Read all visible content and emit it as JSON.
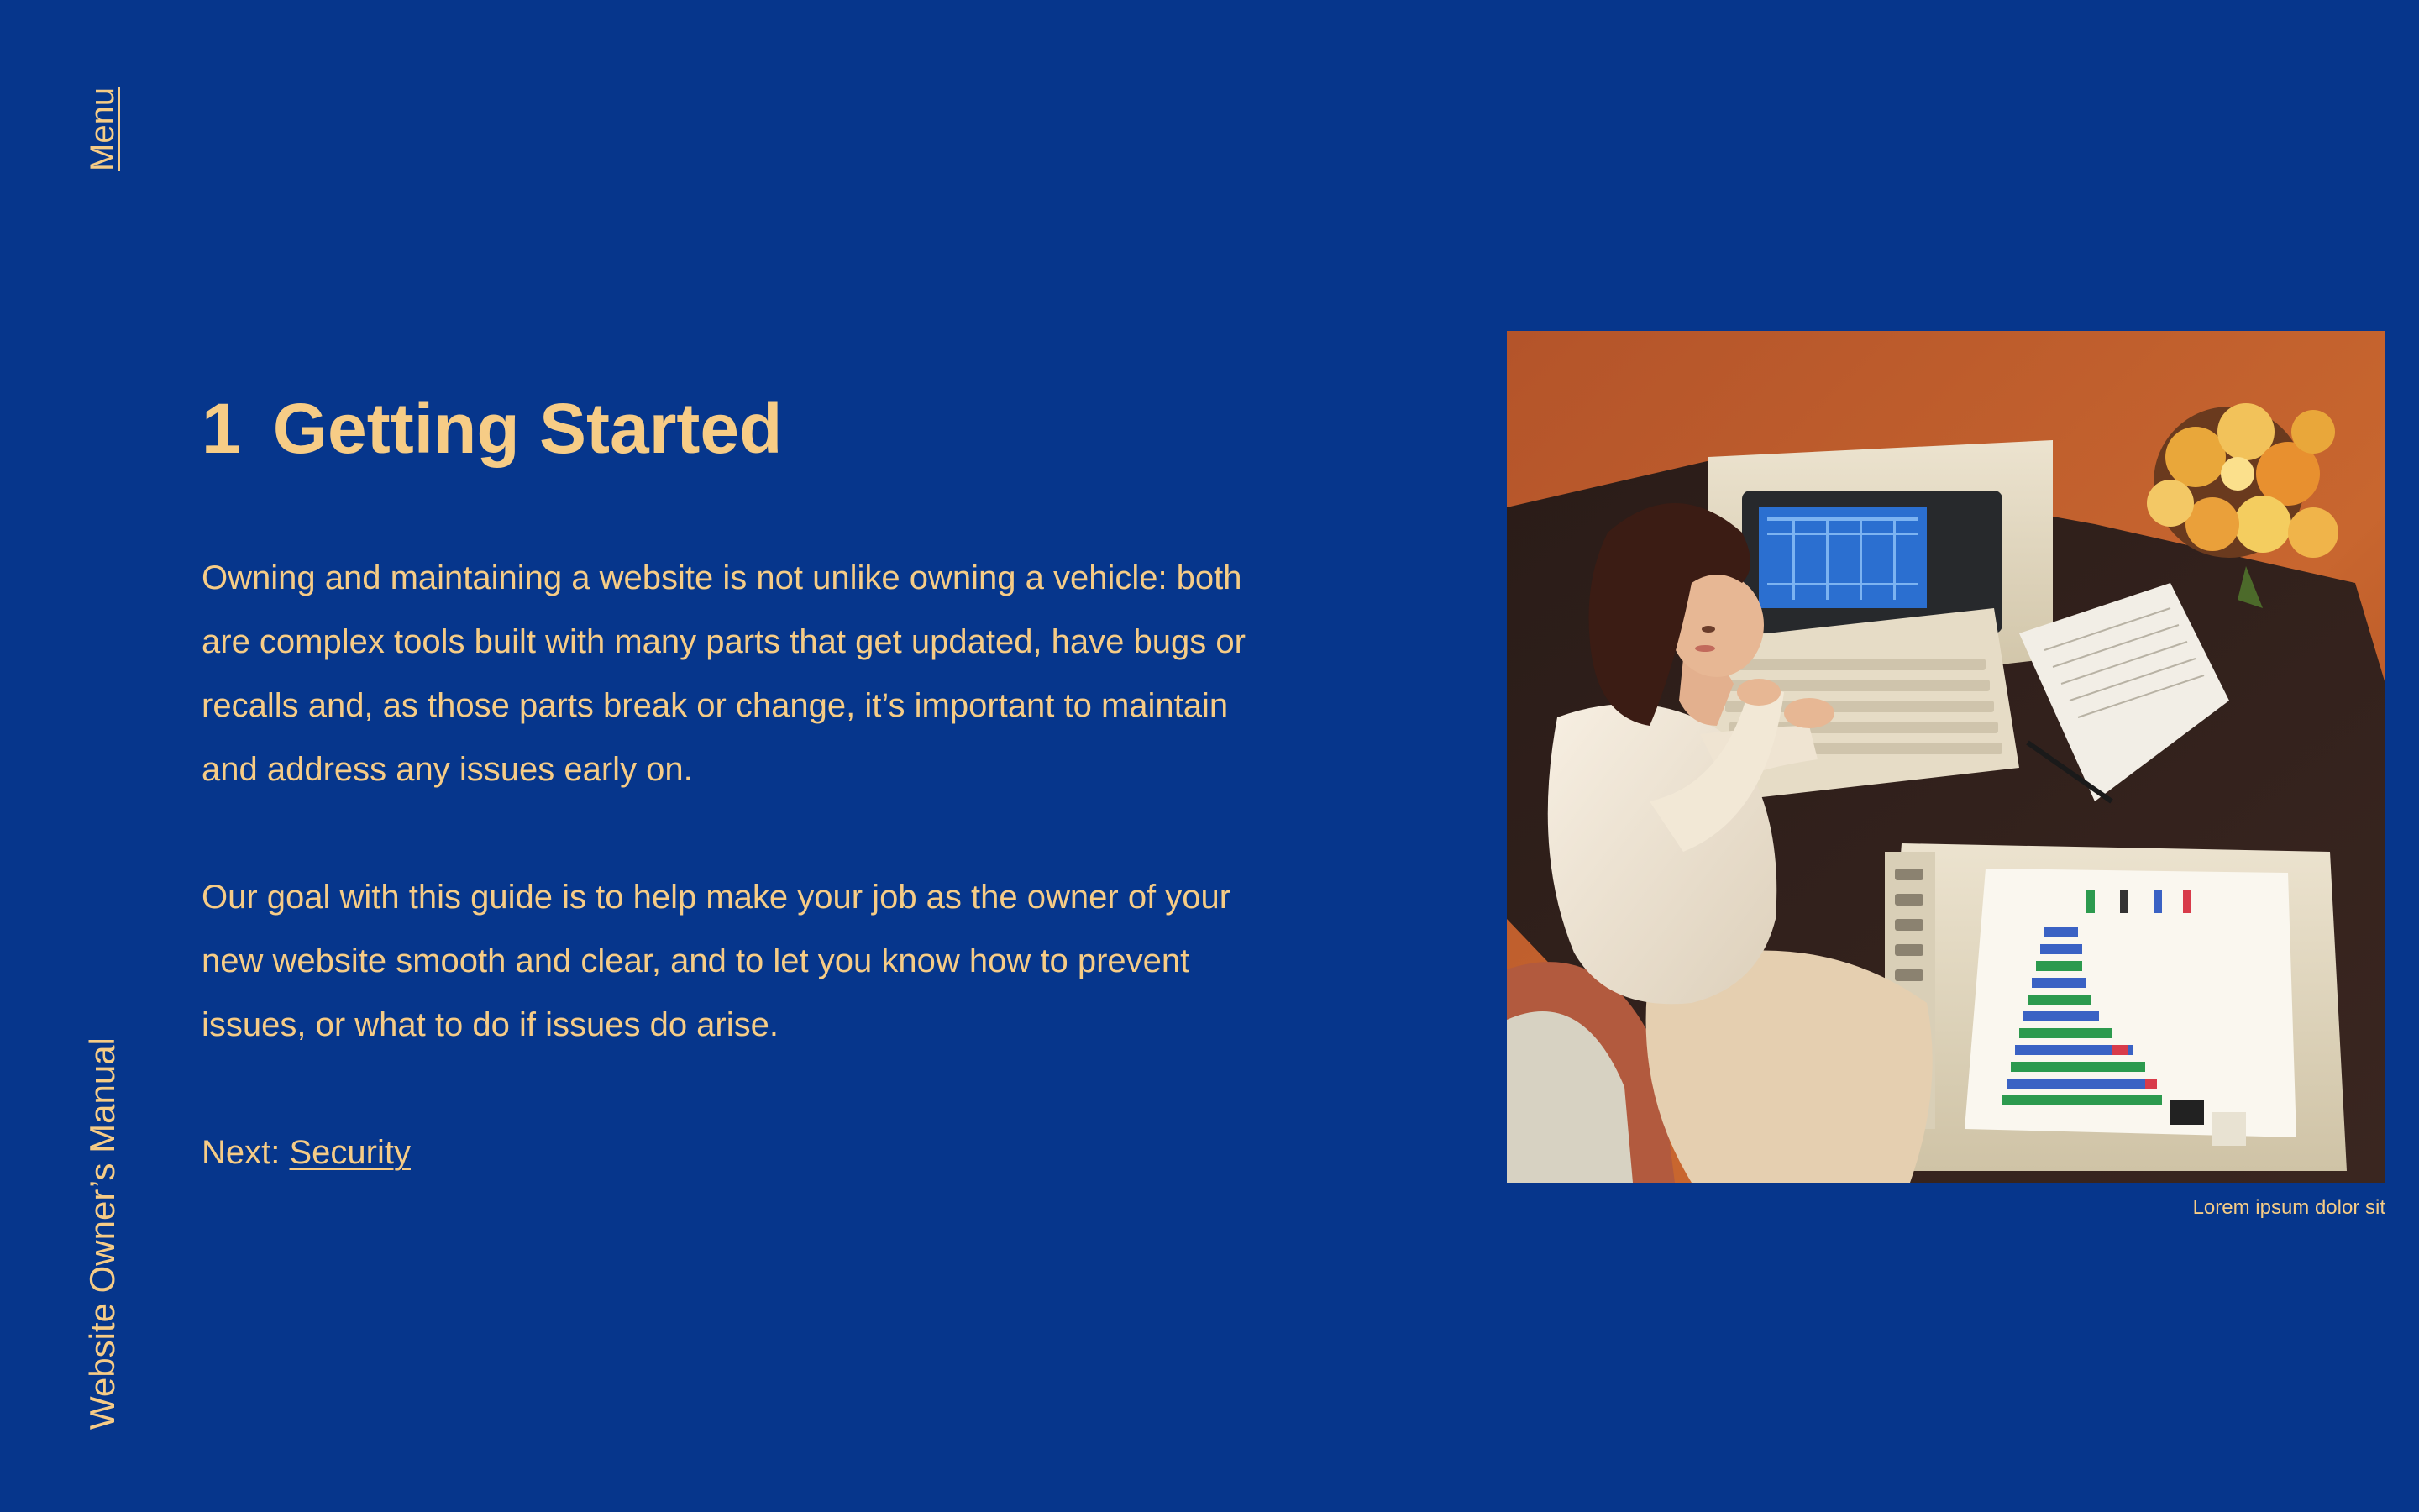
{
  "sidebar": {
    "menu_label": "Menu",
    "site_title": "Website Owner’s Manual"
  },
  "section": {
    "number": "1",
    "title": "Getting Started",
    "paragraphs": [
      "Owning and maintaining a website is not unlike owning a vehicle: both are complex tools built with many parts that get updated, have bugs or recalls and, as those parts break or change, it’s important to maintain and address any issues early on.",
      "Our goal with this guide is to help make your job as the owner of your new website smooth and clear, and to let you know how to prevent issues, or what to do if issues do arise."
    ],
    "next_prefix": "Next:",
    "next_link": "Security"
  },
  "figure": {
    "caption": "Lorem ipsum dolor sit"
  },
  "colors": {
    "background": "#06368c",
    "text": "#f6cc86"
  }
}
